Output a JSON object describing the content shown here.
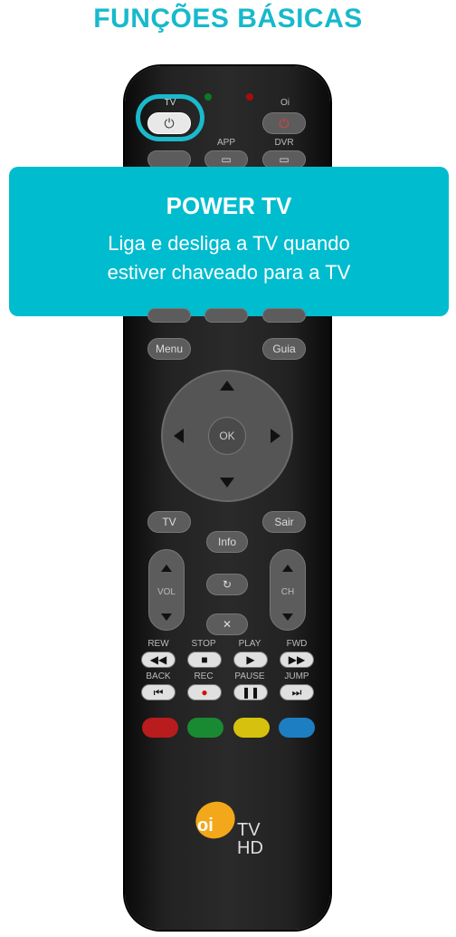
{
  "title": "FUNÇÕES BÁSICAS",
  "tooltip": {
    "title": "POWER TV",
    "description_line1": "Liga e desliga a TV quando",
    "description_line2": "estiver chaveado para a TV"
  },
  "remote": {
    "top_labels": {
      "tv": "TV",
      "oi": "Oi",
      "app": "APP",
      "dvr": "DVR"
    },
    "menu": "Menu",
    "guia": "Guia",
    "ok": "OK",
    "sair": "Sair",
    "tv_small": "TV",
    "info": "Info",
    "vol": "VOL",
    "ch": "CH",
    "transport_labels_row1": [
      "REW",
      "STOP",
      "PLAY",
      "FWD"
    ],
    "transport_labels_row2": [
      "BACK",
      "REC",
      "PAUSE",
      "JUMP"
    ],
    "logo_text_oi": "oi",
    "logo_text_tv": "TV",
    "logo_text_hd": "HD"
  },
  "colors": {
    "accent": "#17b9cc",
    "tooltip_bg": "#00bccf",
    "red_led": "#c81010",
    "green_led": "#0e9a2a",
    "color_buttons": [
      "#b81c1c",
      "#1a8a32",
      "#d6c20e",
      "#1d7ec2"
    ]
  },
  "icons": [
    "power-icon",
    "folder-icon",
    "arrow-up-icon",
    "arrow-down-icon",
    "arrow-left-icon",
    "arrow-right-icon",
    "refresh-icon",
    "mute-icon",
    "rewind-icon",
    "stop-icon",
    "play-icon",
    "fast-forward-icon",
    "skip-back-icon",
    "record-icon",
    "pause-icon",
    "skip-forward-icon"
  ]
}
